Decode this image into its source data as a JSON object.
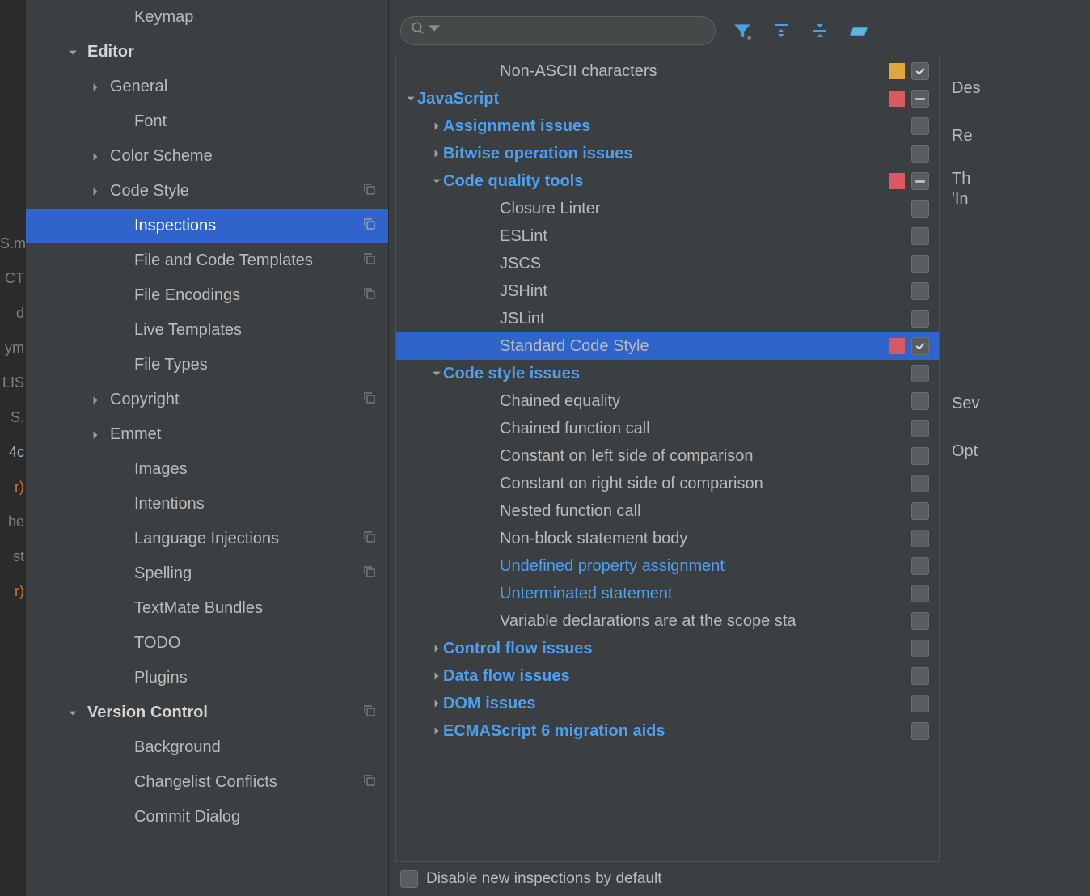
{
  "gutter": {
    "lines": [
      {
        "t": "S.m",
        "c": ""
      },
      {
        "t": "",
        "c": ""
      },
      {
        "t": "CT",
        "c": ""
      },
      {
        "t": "d",
        "c": ""
      },
      {
        "t": "ym",
        "c": ""
      },
      {
        "t": "",
        "c": ""
      },
      {
        "t": "",
        "c": ""
      },
      {
        "t": "",
        "c": ""
      },
      {
        "t": "",
        "c": ""
      },
      {
        "t": "",
        "c": ""
      },
      {
        "t": "",
        "c": ""
      },
      {
        "t": "",
        "c": ""
      },
      {
        "t": "LIS",
        "c": ""
      },
      {
        "t": "S.",
        "c": ""
      },
      {
        "t": "",
        "c": ""
      },
      {
        "t": "",
        "c": ""
      },
      {
        "t": "4c",
        "c": "y"
      },
      {
        "t": "r)",
        "c": "hl"
      },
      {
        "t": "he",
        "c": ""
      },
      {
        "t": "st",
        "c": ""
      },
      {
        "t": "r)",
        "c": "hl"
      }
    ]
  },
  "sidebar": {
    "items": [
      {
        "label": "Keymap",
        "level": 1,
        "arrow": "none"
      },
      {
        "label": "Editor",
        "level": 0,
        "arrow": "down"
      },
      {
        "label": "General",
        "level": 1,
        "arrow": "right"
      },
      {
        "label": "Font",
        "level": 2,
        "arrow": "none"
      },
      {
        "label": "Color Scheme",
        "level": 1,
        "arrow": "right"
      },
      {
        "label": "Code Style",
        "level": 1,
        "arrow": "right",
        "copy": true
      },
      {
        "label": "Inspections",
        "level": 2,
        "arrow": "none",
        "copy": true,
        "selected": true
      },
      {
        "label": "File and Code Templates",
        "level": 2,
        "arrow": "none",
        "copy": true
      },
      {
        "label": "File Encodings",
        "level": 2,
        "arrow": "none",
        "copy": true
      },
      {
        "label": "Live Templates",
        "level": 2,
        "arrow": "none"
      },
      {
        "label": "File Types",
        "level": 2,
        "arrow": "none"
      },
      {
        "label": "Copyright",
        "level": 1,
        "arrow": "right",
        "copy": true
      },
      {
        "label": "Emmet",
        "level": 1,
        "arrow": "right"
      },
      {
        "label": "Images",
        "level": 2,
        "arrow": "none"
      },
      {
        "label": "Intentions",
        "level": 2,
        "arrow": "none"
      },
      {
        "label": "Language Injections",
        "level": 2,
        "arrow": "none",
        "copy": true
      },
      {
        "label": "Spelling",
        "level": 2,
        "arrow": "none",
        "copy": true
      },
      {
        "label": "TextMate Bundles",
        "level": 2,
        "arrow": "none"
      },
      {
        "label": "TODO",
        "level": 2,
        "arrow": "none"
      },
      {
        "label": "Plugins",
        "level": 1,
        "arrow": "none"
      },
      {
        "label": "Version Control",
        "level": 0,
        "arrow": "down",
        "copy": true
      },
      {
        "label": "Background",
        "level": 2,
        "arrow": "none"
      },
      {
        "label": "Changelist Conflicts",
        "level": 2,
        "arrow": "none",
        "copy": true
      },
      {
        "label": "Commit Dialog",
        "level": 2,
        "arrow": "none"
      }
    ]
  },
  "search": {
    "placeholder": ""
  },
  "inspections": [
    {
      "label": "Non-ASCII characters",
      "style": "plain",
      "level": "c",
      "arrow": "none",
      "severity": "yellow",
      "cb": "checked"
    },
    {
      "label": "JavaScript",
      "style": "cat",
      "level": "a",
      "arrow": "down",
      "severity": "red",
      "cb": "mixed"
    },
    {
      "label": "Assignment issues",
      "style": "cat",
      "level": "b",
      "arrow": "right",
      "cb": "empty"
    },
    {
      "label": "Bitwise operation issues",
      "style": "cat",
      "level": "b",
      "arrow": "right",
      "cb": "empty"
    },
    {
      "label": "Code quality tools",
      "style": "cat",
      "level": "b",
      "arrow": "down",
      "severity": "red",
      "cb": "mixed"
    },
    {
      "label": "Closure Linter",
      "style": "plain",
      "level": "c",
      "arrow": "none",
      "cb": "empty"
    },
    {
      "label": "ESLint",
      "style": "plain",
      "level": "c",
      "arrow": "none",
      "cb": "empty"
    },
    {
      "label": "JSCS",
      "style": "plain",
      "level": "c",
      "arrow": "none",
      "cb": "empty"
    },
    {
      "label": "JSHint",
      "style": "plain",
      "level": "c",
      "arrow": "none",
      "cb": "empty"
    },
    {
      "label": "JSLint",
      "style": "plain",
      "level": "c",
      "arrow": "none",
      "cb": "empty"
    },
    {
      "label": "Standard Code Style",
      "style": "plain",
      "level": "c",
      "arrow": "none",
      "severity": "red",
      "cb": "checked",
      "selected": true
    },
    {
      "label": "Code style issues",
      "style": "cat",
      "level": "b",
      "arrow": "down",
      "cb": "empty"
    },
    {
      "label": "Chained equality",
      "style": "plain",
      "level": "c",
      "arrow": "none",
      "cb": "empty"
    },
    {
      "label": "Chained function call",
      "style": "plain",
      "level": "c",
      "arrow": "none",
      "cb": "empty"
    },
    {
      "label": "Constant on left side of comparison",
      "style": "plain",
      "level": "c",
      "arrow": "none",
      "cb": "empty"
    },
    {
      "label": "Constant on right side of comparison",
      "style": "plain",
      "level": "c",
      "arrow": "none",
      "cb": "empty"
    },
    {
      "label": "Nested function call",
      "style": "plain",
      "level": "c",
      "arrow": "none",
      "cb": "empty"
    },
    {
      "label": "Non-block statement body",
      "style": "plain",
      "level": "c",
      "arrow": "none",
      "cb": "empty"
    },
    {
      "label": "Undefined property assignment",
      "style": "link",
      "level": "c",
      "arrow": "none",
      "cb": "empty"
    },
    {
      "label": "Unterminated statement",
      "style": "link",
      "level": "c",
      "arrow": "none",
      "cb": "empty"
    },
    {
      "label": "Variable declarations are at the scope sta",
      "style": "plain",
      "level": "c",
      "arrow": "none",
      "cb": "empty"
    },
    {
      "label": "Control flow issues",
      "style": "cat",
      "level": "b",
      "arrow": "right",
      "cb": "empty"
    },
    {
      "label": "Data flow issues",
      "style": "cat",
      "level": "b",
      "arrow": "right",
      "cb": "empty"
    },
    {
      "label": "DOM issues",
      "style": "cat",
      "level": "b",
      "arrow": "right",
      "cb": "empty"
    },
    {
      "label": "ECMAScript 6 migration aids",
      "style": "cat",
      "level": "b",
      "arrow": "right",
      "cb": "empty"
    }
  ],
  "footer": {
    "disable_label": "Disable new inspections by default"
  },
  "right": {
    "desc": "Des",
    "re": "Re",
    "th": "Th",
    "in": "'In",
    "sev": "Sev",
    "opt": "Opt"
  }
}
